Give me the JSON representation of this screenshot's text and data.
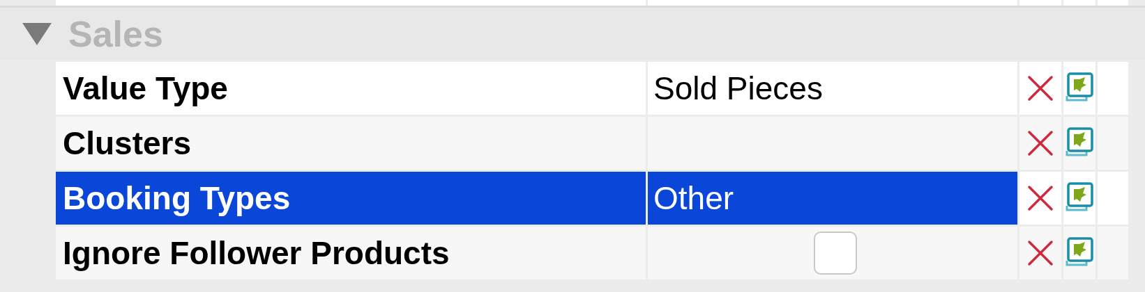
{
  "section": {
    "title": "Sales",
    "expanded": true
  },
  "rows": [
    {
      "kind": "text",
      "name": "Value Type",
      "value": "Sold Pieces",
      "selected": false
    },
    {
      "kind": "text",
      "name": "Clusters",
      "selected": false
    },
    {
      "kind": "text",
      "name": "Booking Types",
      "value": "Other",
      "selected": true
    },
    {
      "kind": "checkbox",
      "name": "Ignore Follower Products",
      "checked": false,
      "selected": false
    }
  ]
}
